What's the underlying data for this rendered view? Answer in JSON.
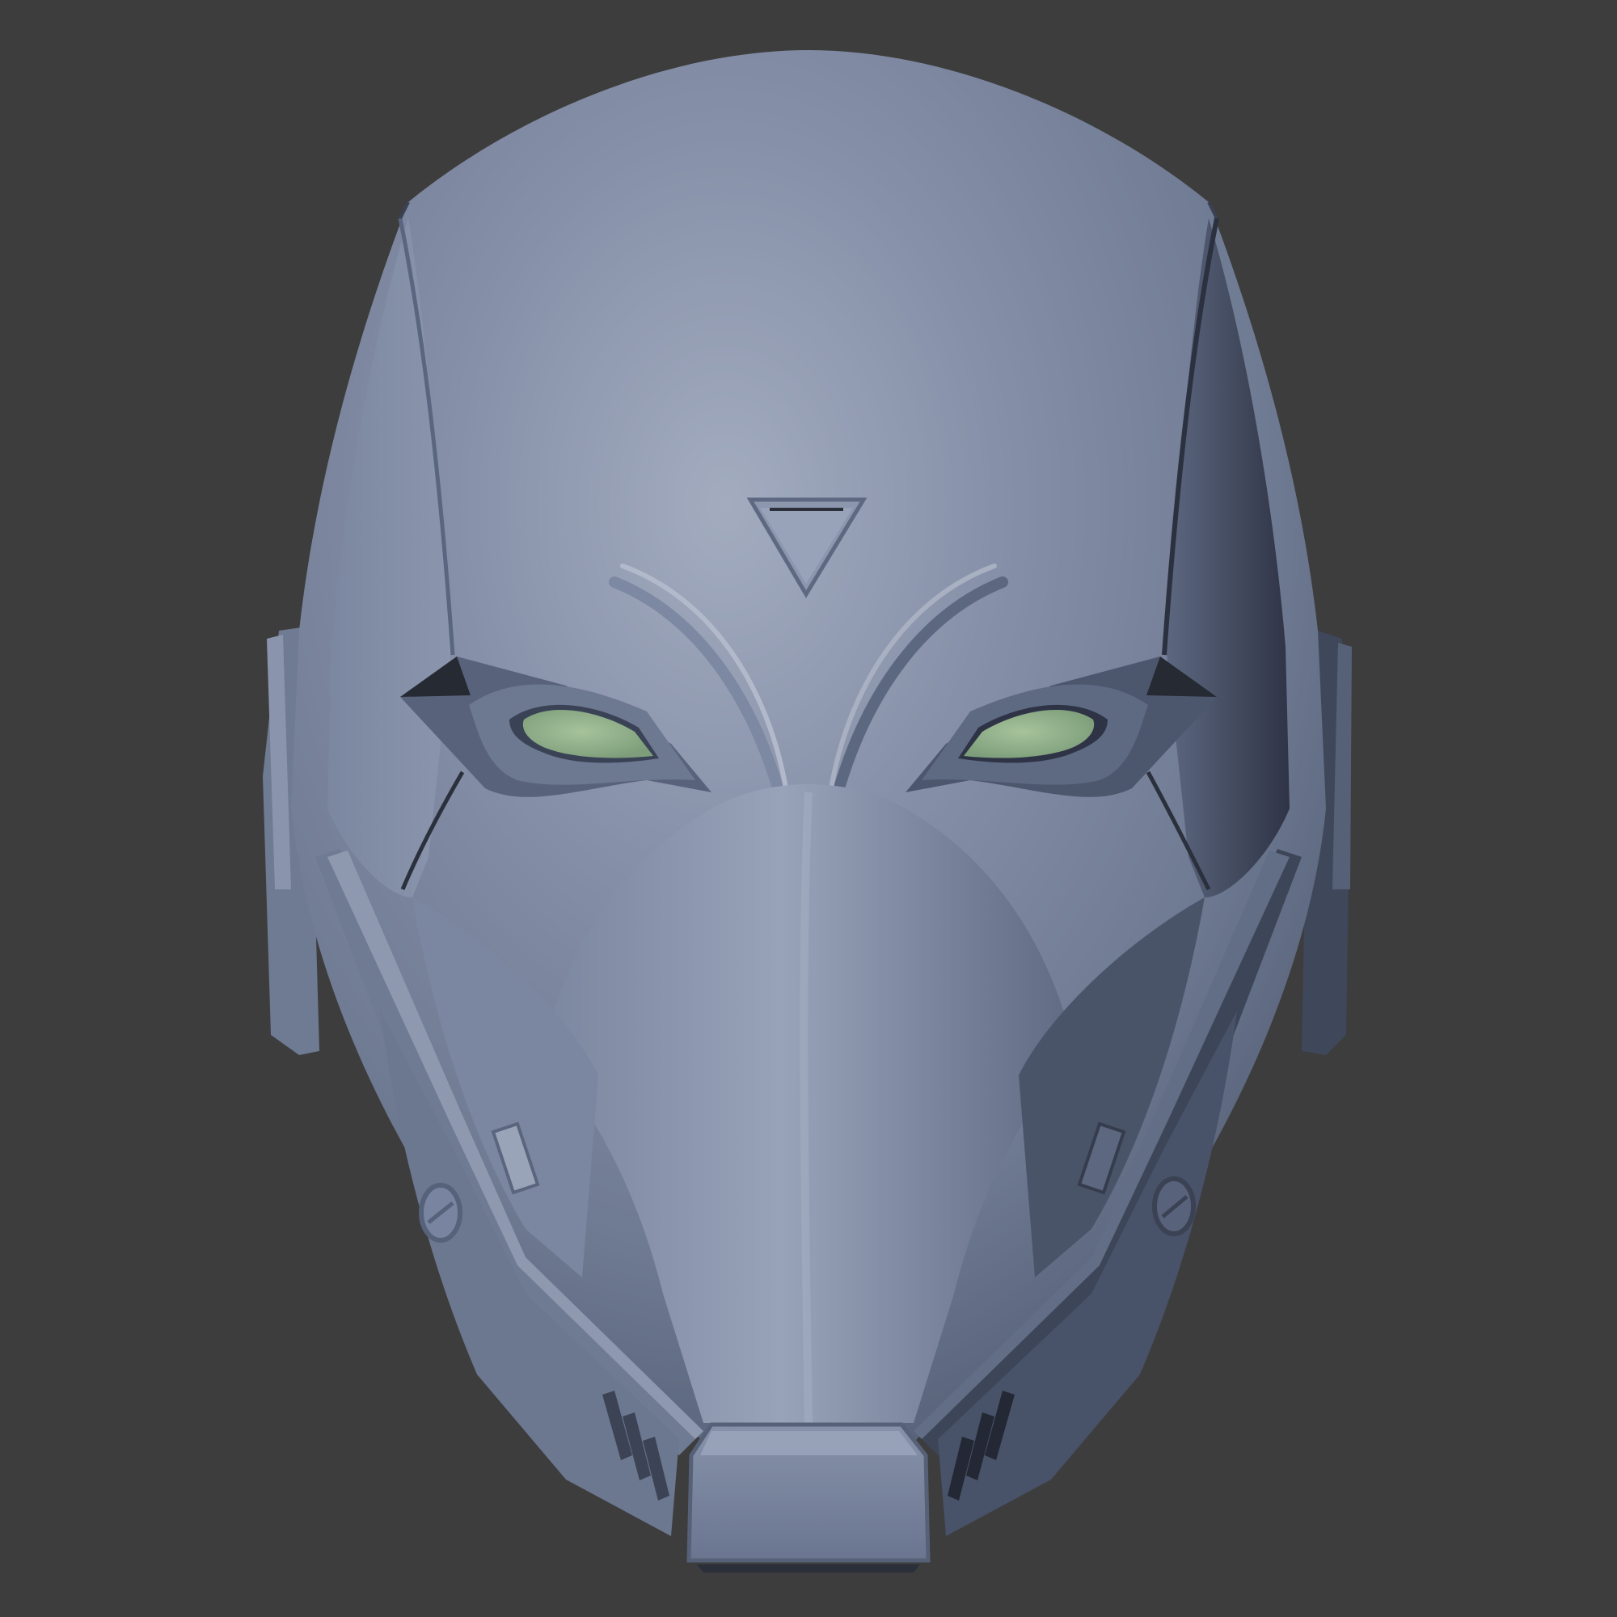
{
  "scene": {
    "background_color": "#3d3d3d",
    "subject": "helmet-render",
    "colors": {
      "base": "#7a87a1",
      "light": "#a3acbf",
      "mid": "#6f7b93",
      "dark": "#4f5a70",
      "deep_shadow": "#2e3344",
      "crease": "#262a33",
      "eye_lens": "#8fb08a",
      "eye_lens_light": "#a6c39b"
    },
    "icons": [
      "triangle-emblem-icon",
      "bolt-circle-icon"
    ]
  }
}
